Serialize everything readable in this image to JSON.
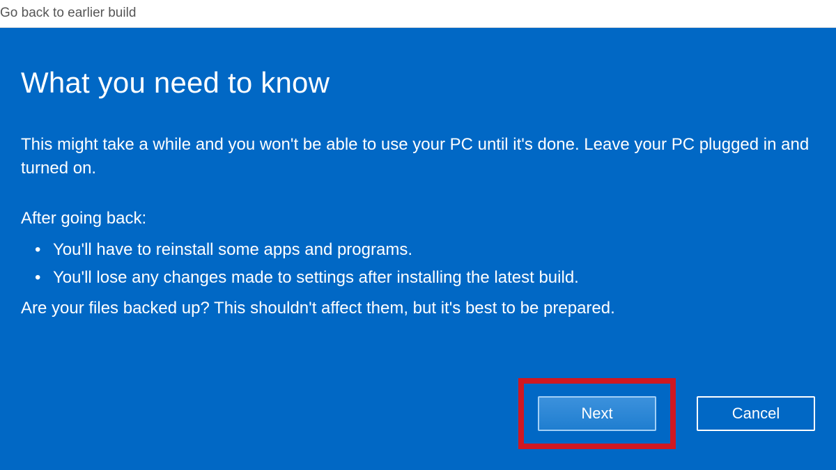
{
  "window": {
    "title": "Go back to earlier build"
  },
  "content": {
    "heading": "What you need to know",
    "paragraph1": "This might take a while and you won't be able to use your PC until it's done. Leave your PC plugged in and turned on.",
    "subheading": "After going back:",
    "bullets": [
      "You'll have to reinstall some apps and programs.",
      "You'll lose any changes made to settings after installing the latest build."
    ],
    "paragraph2": "Are your files backed up? This shouldn't affect them, but it's best to be prepared."
  },
  "buttons": {
    "next": "Next",
    "cancel": "Cancel"
  }
}
